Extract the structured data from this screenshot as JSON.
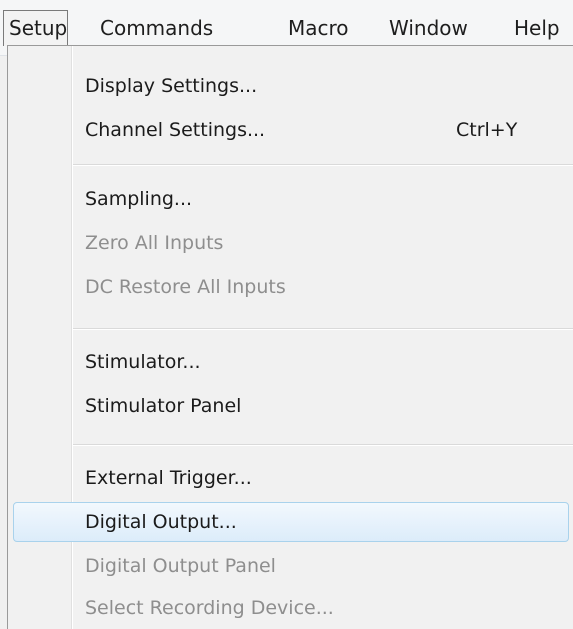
{
  "menubar": {
    "items": [
      {
        "label": "Setup",
        "active": true
      },
      {
        "label": "Commands"
      },
      {
        "label": "Macro"
      },
      {
        "label": "Window"
      },
      {
        "label": "Help"
      }
    ]
  },
  "setup_menu": {
    "items": [
      {
        "label": "Display Settings...",
        "enabled": true
      },
      {
        "label": "Channel Settings...",
        "shortcut": "Ctrl+Y",
        "enabled": true
      },
      {
        "label": "Sampling...",
        "enabled": true
      },
      {
        "label": "Zero All Inputs",
        "enabled": false
      },
      {
        "label": "DC Restore All Inputs",
        "enabled": false
      },
      {
        "label": "Stimulator...",
        "enabled": true
      },
      {
        "label": "Stimulator Panel",
        "enabled": true
      },
      {
        "label": "External Trigger...",
        "enabled": true
      },
      {
        "label": "Digital Output...",
        "enabled": true,
        "highlighted": true
      },
      {
        "label": "Digital Output Panel",
        "enabled": false
      },
      {
        "label": "Select Recording Device...",
        "enabled": false
      }
    ]
  },
  "colors": {
    "highlight_border": "#a9d2ec",
    "highlight_fill": "#dcecfa",
    "disabled_text": "#8e8e8e"
  }
}
